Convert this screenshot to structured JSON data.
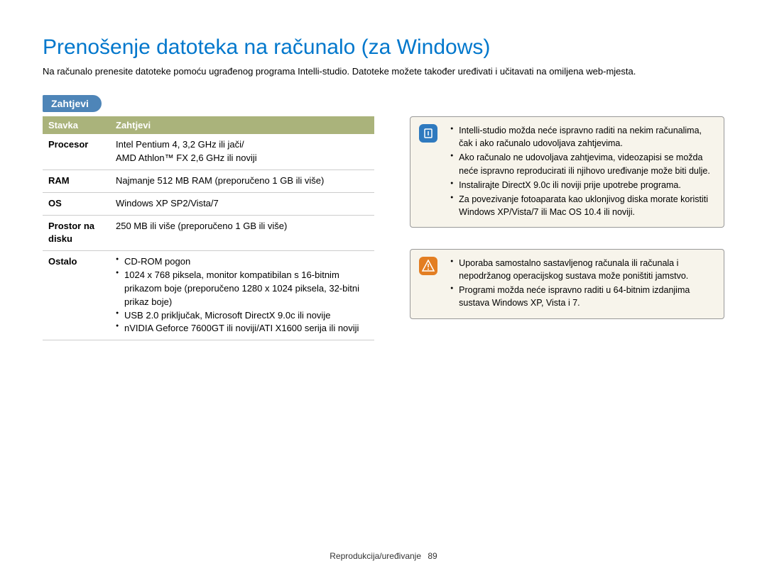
{
  "page_title": "Prenošenje datoteka na računalo (za Windows)",
  "intro": "Na računalo prenesite datoteke pomoću ugrađenog programa Intelli-studio. Datoteke možete također uređivati i učitavati na omiljena web-mjesta.",
  "section_label": "Zahtjevi",
  "table": {
    "header_item": "Stavka",
    "header_req": "Zahtjevi",
    "rows": {
      "processor_label": "Procesor",
      "processor_value": "Intel Pentium 4, 3,2 GHz ili jači/\nAMD Athlon™ FX 2,6 GHz ili noviji",
      "ram_label": "RAM",
      "ram_value": "Najmanje 512 MB RAM (preporučeno 1 GB ili više)",
      "os_label": "OS",
      "os_value": "Windows XP SP2/Vista/7",
      "disk_label": "Prostor na disku",
      "disk_value": "250 MB ili više (preporučeno 1 GB ili više)",
      "other_label": "Ostalo",
      "other_items": [
        "CD-ROM pogon",
        "1024 x 768 piksela, monitor kompatibilan s 16-bitnim prikazom boje (preporučeno 1280 x 1024 piksela, 32-bitni prikaz boje)",
        "USB 2.0 priključak, Microsoft DirectX 9.0c ili novije",
        "nVIDIA Geforce 7600GT ili noviji/ATI X1600 serija ili noviji"
      ]
    }
  },
  "info_note": {
    "items": [
      "Intelli-studio možda neće ispravno raditi na nekim računalima, čak i ako računalo udovoljava zahtjevima.",
      "Ako računalo ne udovoljava zahtjevima, videozapisi se možda neće ispravno reproducirati ili njihovo uređivanje može biti dulje.",
      "Instalirajte DirectX 9.0c ili noviji prije upotrebe programa.",
      "Za povezivanje fotoaparata kao uklonjivog diska morate koristiti Windows XP/Vista/7 ili Mac OS 10.4 ili noviji."
    ]
  },
  "warn_note": {
    "items": [
      "Uporaba samostalno sastavljenog računala ili računala i nepodržanog operacijskog sustava može poništiti jamstvo.",
      "Programi možda neće ispravno raditi u 64-bitnim izdanjima sustava Windows XP, Vista i 7."
    ]
  },
  "footer": {
    "label": "Reprodukcija/uređivanje",
    "page": "89"
  }
}
